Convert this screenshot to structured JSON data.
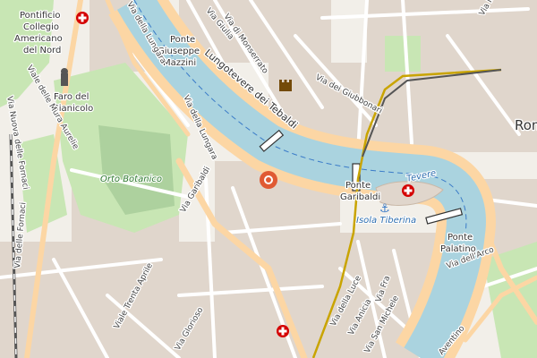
{
  "map": {
    "colors": {
      "land": "#f2efe9",
      "block": "#e0d6cc",
      "water": "#aad3df",
      "riverbank_road": "#fcd6a4",
      "park": "#c8e6b4",
      "garden": "#add19e",
      "rail": "#555555",
      "tram": "#c9a400",
      "hospital": "#d40000",
      "marker": "#e05a33"
    },
    "labels": {
      "pontificio": "Pontificio",
      "collegio": "Collegio",
      "americano": "Americano",
      "del_nord": "del Nord",
      "faro1": "Faro del",
      "faro2": "Gianicolo",
      "orto": "Orto Botanico",
      "ponte_mazzini_1": "Ponte",
      "ponte_mazzini_2": "Giuseppe",
      "ponte_mazzini_3": "Mazzini",
      "lungotevere": "Lungotevere dei Tebaldi",
      "ponte_garibaldi_1": "Ponte",
      "ponte_garibaldi_2": "Garibaldi",
      "ponte_palatino_1": "Ponte",
      "ponte_palatino_2": "Palatino",
      "isola": "Isola Tiberina",
      "tevere": "Tevere",
      "roma": "Roma",
      "via_lungara_1": "Via della Lungara",
      "via_lungara_2": "Via della Lungara",
      "via_giulia": "Via Giulia",
      "via_monserrato": "Via di Monserrato",
      "via_giubbonari": "Via dei Giubbonari",
      "via_garibaldi": "Via Garibaldi",
      "via_nuova_fornaci": "Via Nuova delle Fornaci",
      "via_fornaci": "Via delle Fornaci",
      "via_mura_aurelie": "Viale delle Mura Aurelie",
      "viale_trenta": "Viale Trenta Aprile",
      "via_luce": "Via della Luce",
      "via_anicia": "Via Anicia",
      "via_san_michele": "Via San Michele",
      "aventino": "Aventino",
      "via_glorioso": "Via Glorioso",
      "via_fra": "Via Fra",
      "via_nicola": "Via Nicola",
      "via_arco": "Via dell'Arco"
    },
    "icons": {
      "hospital": "hospital-cross-icon",
      "castle": "castle-icon",
      "anchor": "anchor-icon",
      "marker": "location-marker-icon"
    }
  }
}
